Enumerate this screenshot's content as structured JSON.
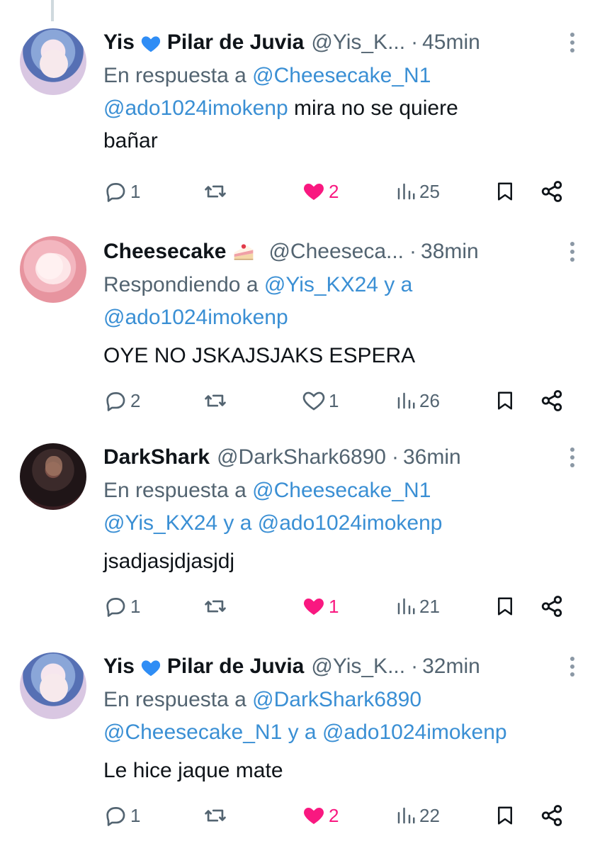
{
  "tweets": [
    {
      "name": "Yis",
      "name_suffix": "Pilar de Juvia",
      "handle": "@Yis_K...",
      "time": "45min",
      "reply_prefix": "En respuesta a",
      "reply_line1": "@Cheesecake_N1",
      "reply_line2_a": "",
      "reply_line2_y": "",
      "reply_line2_b": "",
      "body_mention": "@ado1024imokenp",
      "body_text": " mira no se quiere",
      "body_text2": "bañar",
      "replies": "1",
      "likes": "2",
      "views": "25",
      "liked": true
    },
    {
      "name": "Cheesecake",
      "handle": "@Cheeseca...",
      "time": "38min",
      "reply_prefix": "Respondiendo a",
      "reply_line1": "@Yis_KX24 y a",
      "reply_line2": "@ado1024imokenp",
      "body_text": "OYE NO JSKAJSJAKS ESPERA",
      "replies": "2",
      "likes": "1",
      "views": "26",
      "liked": false
    },
    {
      "name": "DarkShark",
      "handle": "@DarkShark6890",
      "time": "36min",
      "reply_prefix": "En respuesta a",
      "reply_line1": "@Cheesecake_N1",
      "reply_line2_a": "@Yis_KX24",
      "reply_line2_y": " y a ",
      "reply_line2_b": "@ado1024imokenp",
      "body_text": "jsadjasjdjasjdj",
      "replies": "1",
      "likes": "1",
      "views": "21",
      "liked": true
    },
    {
      "name": "Yis",
      "name_suffix": "Pilar de Juvia",
      "handle": "@Yis_K...",
      "time": "32min",
      "reply_prefix": "En respuesta a",
      "reply_line1": "@DarkShark6890",
      "reply_line2_a": "@Cheesecake_N1",
      "reply_line2_y": " y a ",
      "reply_line2_b": "@ado1024imokenp",
      "body_text": "Le hice jaque mate",
      "replies": "1",
      "likes": "2",
      "views": "22",
      "liked": true
    }
  ],
  "icons": {
    "reply": "reply-icon",
    "retweet": "retweet-icon",
    "like": "heart-icon",
    "views": "views-icon",
    "bookmark": "bookmark-icon",
    "share": "share-icon",
    "more": "more-icon"
  },
  "colors": {
    "text": "#0f1419",
    "secondary": "#536471",
    "link": "#3a8fd4",
    "like": "#f91880",
    "blue_heart": "#1d9bf0"
  }
}
